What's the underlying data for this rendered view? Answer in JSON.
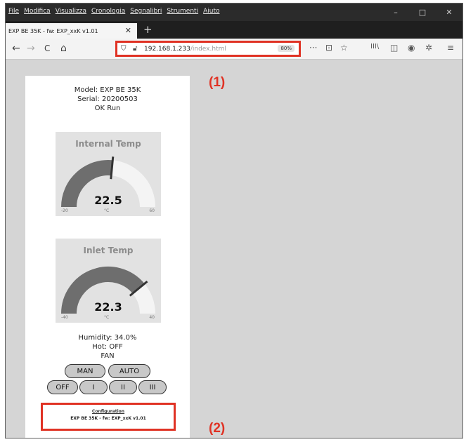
{
  "menu": [
    "File",
    "Modifica",
    "Visualizza",
    "Cronologia",
    "Segnalibri",
    "Strumenti",
    "Aiuto"
  ],
  "window_controls": {
    "minimize": "–",
    "maximize": "□",
    "close": "✕"
  },
  "tab": {
    "title": "EXP BE 35K - fw: EXP_xxK v1.01",
    "close": "✕",
    "new_tab": "+"
  },
  "nav": {
    "back": "←",
    "forward": "→",
    "reload": "C",
    "home": "⌂"
  },
  "url": {
    "host": "192.168.1.233",
    "path": "/index.html",
    "zoom": "80%"
  },
  "toolbar_icons": {
    "more": "···",
    "pocket": "⊡",
    "bookmark": "☆",
    "library": "III\\",
    "sidebar": "◫",
    "account": "◉",
    "extension": "✲",
    "menu": "≡"
  },
  "device": {
    "model": "Model:  EXP BE 35K",
    "serial": "Serial:  20200503",
    "status": "OK Run"
  },
  "gauges": [
    {
      "title": "Internal Temp",
      "value": "22.5",
      "min_label": "-20",
      "unit": "°C",
      "max_label": "60",
      "level": 0.53
    },
    {
      "title": "Inlet Temp",
      "value": "22.3",
      "min_label": "-40",
      "unit": "°C",
      "max_label": "40",
      "level": 0.78
    }
  ],
  "stats": {
    "humidity": "Humidity:  34.0%",
    "hot": "Hot:  OFF",
    "fan": "FAN"
  },
  "buttons": {
    "man": "MAN",
    "auto": "AUTO",
    "off": "OFF",
    "one": "I",
    "two": "II",
    "three": "III"
  },
  "config": {
    "link": "Configuration",
    "version": "EXP BE 35K - fw: EXP_xxK v1.01"
  },
  "annotations": {
    "one": "(1)",
    "two": "(2)"
  },
  "colors": {
    "accent_red": "#e03224",
    "gauge_dark": "#6e6e6e",
    "gauge_light": "#f4f4f4",
    "needle": "#333333"
  }
}
